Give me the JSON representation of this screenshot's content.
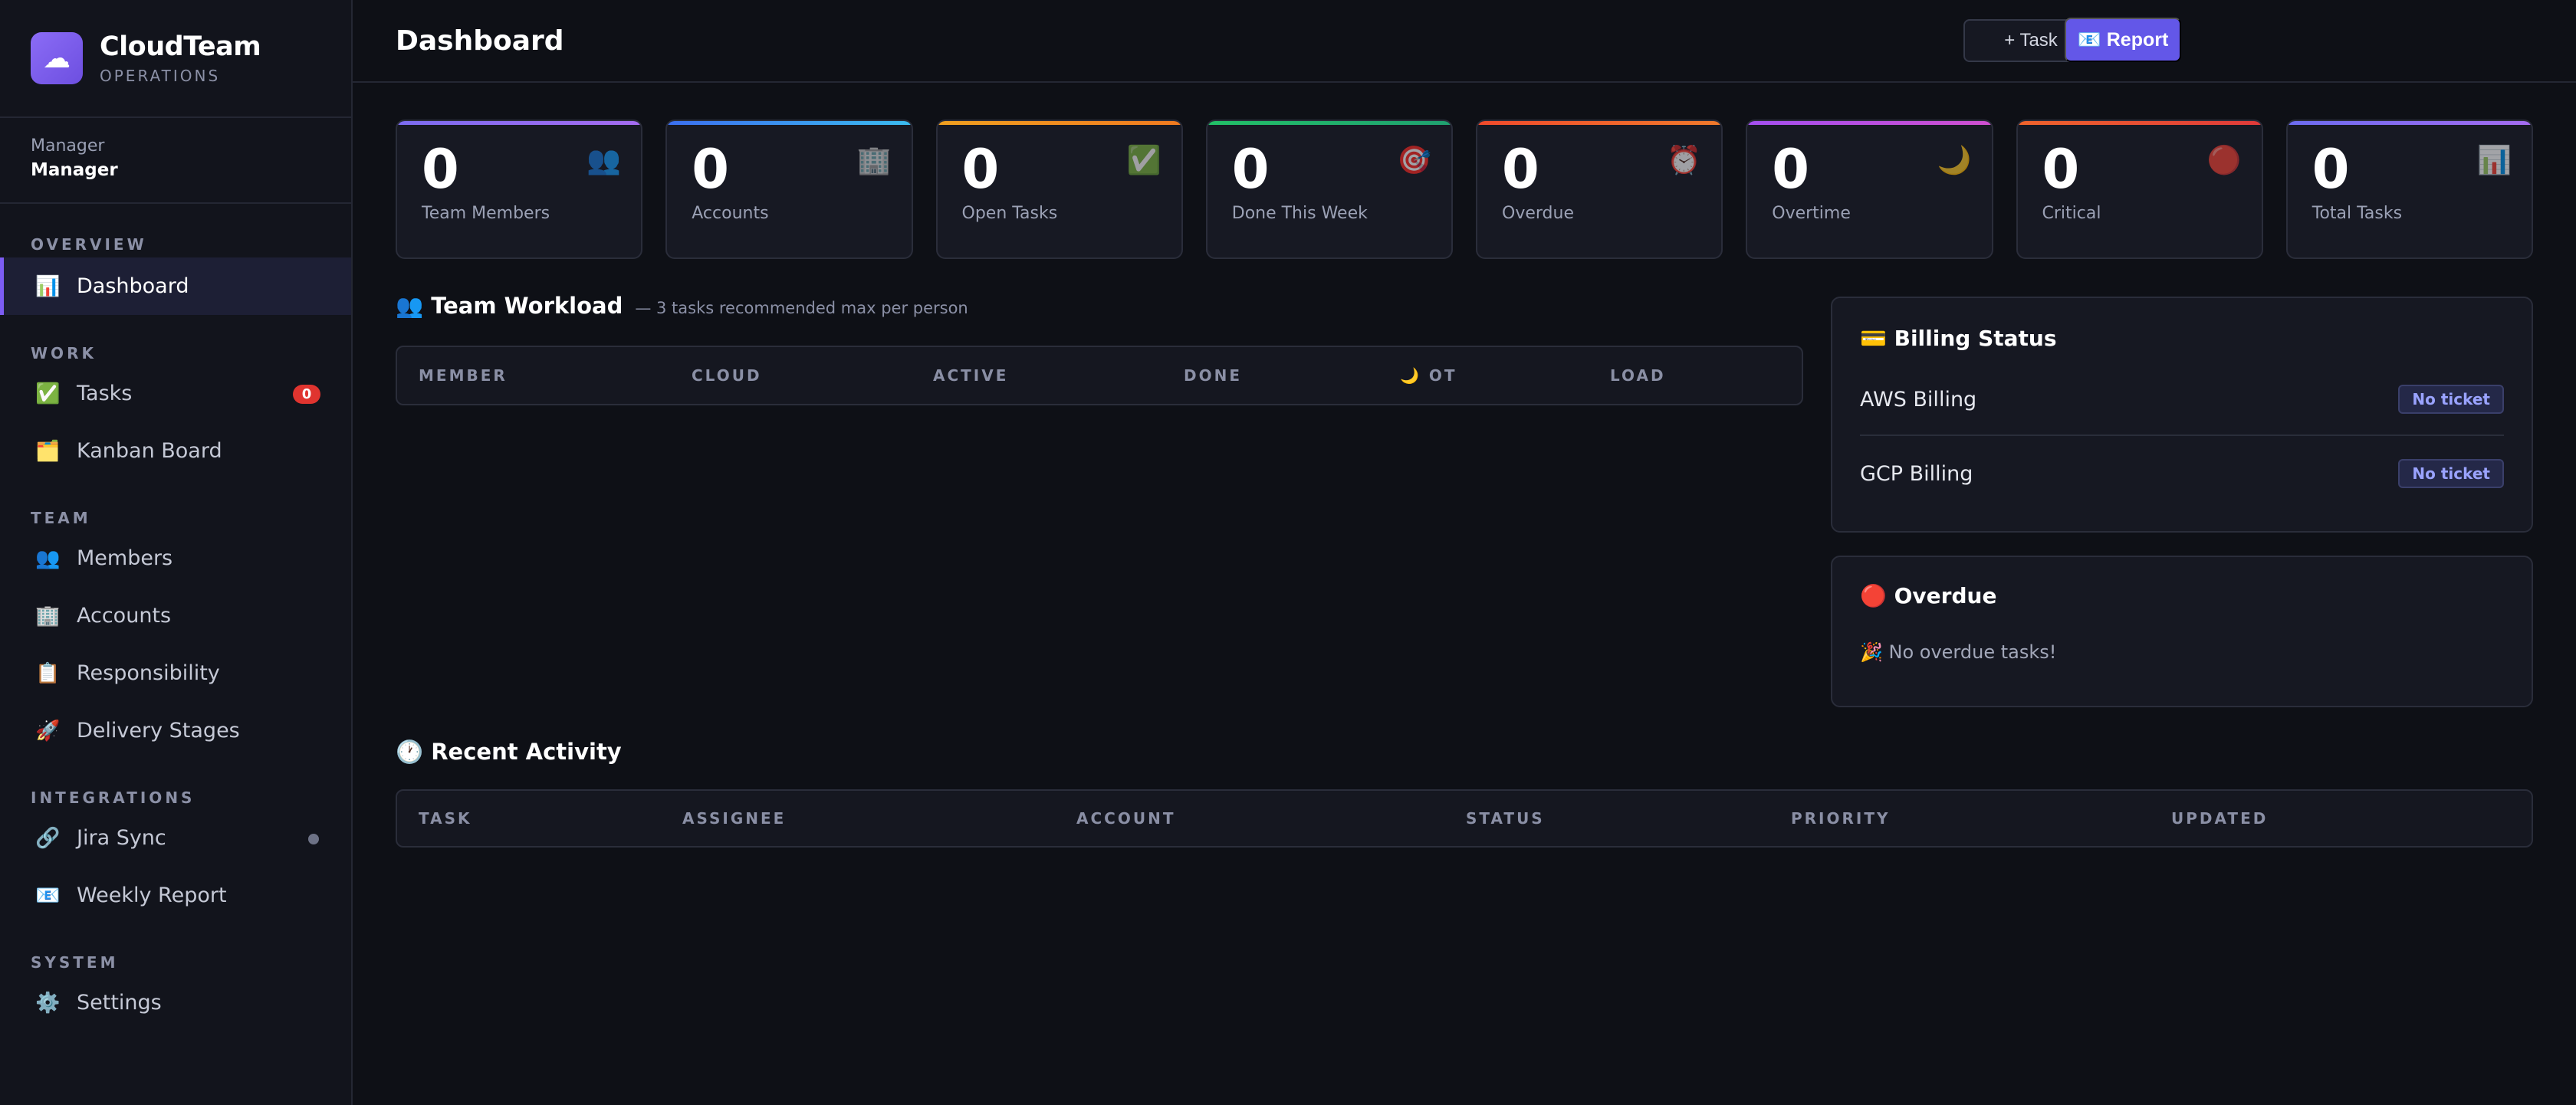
{
  "brand": {
    "name": "CloudTeam",
    "subtitle": "OPERATIONS",
    "logo_icon": "cloud-icon",
    "logo_glyph": "☁"
  },
  "user": {
    "role_label": "Manager",
    "role_name": "Manager"
  },
  "sidebar": {
    "sections": {
      "overview": "OVERVIEW",
      "work": "WORK",
      "team": "TEAM",
      "integrations": "INTEGRATIONS",
      "system": "SYSTEM"
    },
    "items": [
      {
        "label": "Dashboard",
        "icon": "📊",
        "active": true
      },
      {
        "label": "Tasks",
        "icon": "✅",
        "badge": "0"
      },
      {
        "label": "Kanban Board",
        "icon": "🗂️"
      },
      {
        "label": "Members",
        "icon": "👥"
      },
      {
        "label": "Accounts",
        "icon": "🏢"
      },
      {
        "label": "Responsibility",
        "icon": "📋"
      },
      {
        "label": "Delivery Stages",
        "icon": "🚀"
      },
      {
        "label": "Jira Sync",
        "icon": "🔗"
      },
      {
        "label": "Weekly Report",
        "icon": "📧"
      },
      {
        "label": "Settings",
        "icon": "⚙️"
      }
    ]
  },
  "header": {
    "title": "Dashboard",
    "task_button": "+ Task",
    "report_button": "📧 Report"
  },
  "stats": [
    {
      "value": "0",
      "label": "Team Members",
      "icon": "👥",
      "color": "#7c6cf0"
    },
    {
      "value": "0",
      "label": "Accounts",
      "icon": "🏢",
      "color": "#3b8ff0"
    },
    {
      "value": "0",
      "label": "Open Tasks",
      "icon": "✅",
      "color": "#f0a020"
    },
    {
      "value": "0",
      "label": "Done This Week",
      "icon": "🎯",
      "color": "#22c068"
    },
    {
      "value": "0",
      "label": "Overdue",
      "icon": "⏰",
      "color": "#f05a2c"
    },
    {
      "value": "0",
      "label": "Overtime",
      "icon": "🌙",
      "color": "#a34ff0"
    },
    {
      "value": "0",
      "label": "Critical",
      "icon": "🔴",
      "color": "#f0642c"
    },
    {
      "value": "0",
      "label": "Total Tasks",
      "icon": "📊",
      "color": "#7c6cf0"
    }
  ],
  "workload": {
    "title": "👥 Team Workload",
    "subtitle": "— 3 tasks recommended max per person",
    "columns": [
      "MEMBER",
      "CLOUD",
      "ACTIVE",
      "DONE",
      "🌙 OT",
      "LOAD"
    ]
  },
  "billing": {
    "title": "💳 Billing Status",
    "rows": [
      {
        "name": "AWS Billing",
        "status": "No ticket"
      },
      {
        "name": "GCP Billing",
        "status": "No ticket"
      }
    ]
  },
  "overdue": {
    "title": "🔴 Overdue",
    "empty": "🎉 No overdue tasks!"
  },
  "activity": {
    "title": "🕐 Recent Activity",
    "columns": [
      "TASK",
      "ASSIGNEE",
      "ACCOUNT",
      "STATUS",
      "PRIORITY",
      "UPDATED"
    ]
  }
}
